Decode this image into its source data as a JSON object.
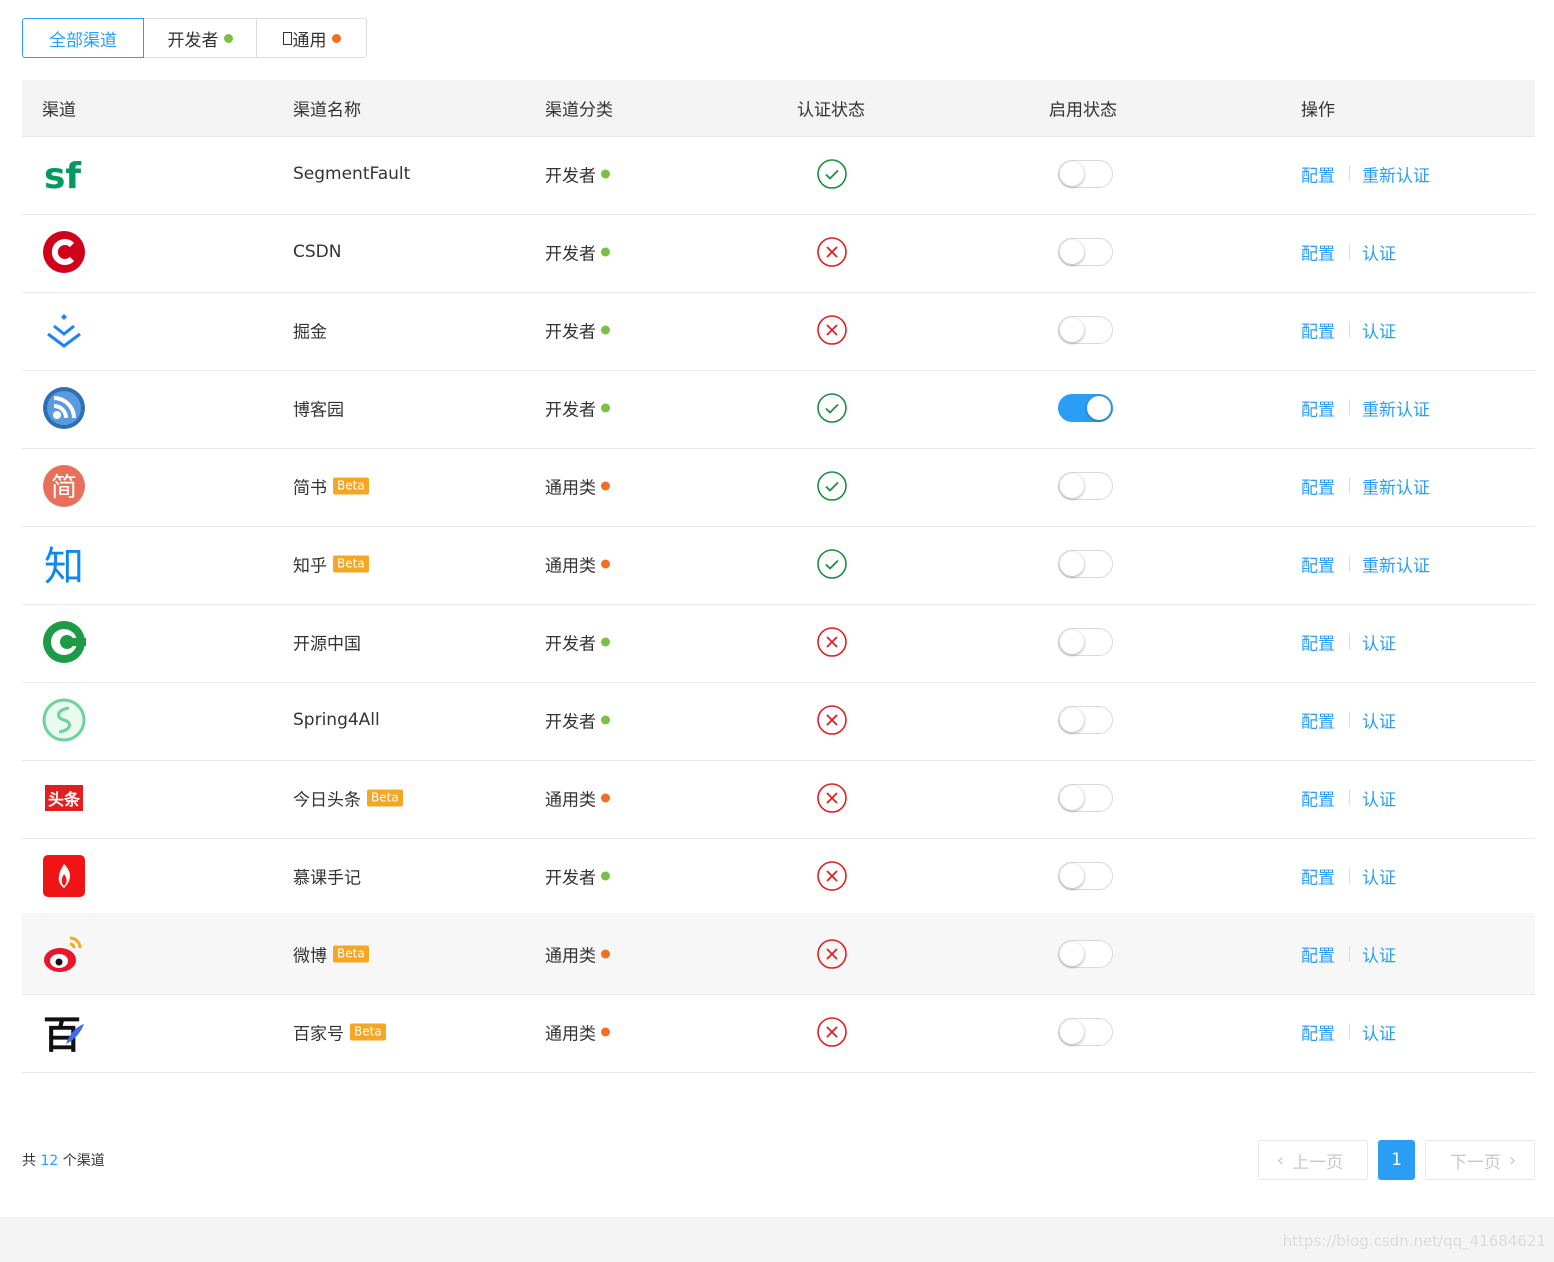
{
  "tabs": [
    {
      "label": "全部渠道",
      "active": true
    },
    {
      "label": "开发者",
      "dot_color": "#7ac143"
    },
    {
      "label": "通用",
      "dot_color": "#f26f21"
    }
  ],
  "table": {
    "headers": {
      "channel": "渠道",
      "name": "渠道名称",
      "category": "渠道分类",
      "auth_status": "认证状态",
      "enable_status": "启用状态",
      "actions": "操作"
    },
    "rows": [
      {
        "logo": "segmentfault-logo",
        "name": "SegmentFault",
        "beta": "",
        "category": "开发者",
        "cat_color": "#7ac143",
        "authed": true,
        "enabled": false,
        "config": "配置",
        "auth_action": "重新认证"
      },
      {
        "logo": "csdn-logo",
        "name": "CSDN",
        "beta": "",
        "category": "开发者",
        "cat_color": "#7ac143",
        "authed": false,
        "enabled": false,
        "config": "配置",
        "auth_action": "认证"
      },
      {
        "logo": "juejin-logo",
        "name": "掘金",
        "beta": "",
        "category": "开发者",
        "cat_color": "#7ac143",
        "authed": false,
        "enabled": false,
        "config": "配置",
        "auth_action": "认证"
      },
      {
        "logo": "cnblogs-logo",
        "name": "博客园",
        "beta": "",
        "category": "开发者",
        "cat_color": "#7ac143",
        "authed": true,
        "enabled": true,
        "config": "配置",
        "auth_action": "重新认证"
      },
      {
        "logo": "jianshu-logo",
        "name": "简书",
        "beta": "Beta",
        "category": "通用类",
        "cat_color": "#f26f21",
        "authed": true,
        "enabled": false,
        "config": "配置",
        "auth_action": "重新认证"
      },
      {
        "logo": "zhihu-logo",
        "name": "知乎",
        "beta": "Beta",
        "category": "通用类",
        "cat_color": "#f26f21",
        "authed": true,
        "enabled": false,
        "config": "配置",
        "auth_action": "重新认证"
      },
      {
        "logo": "oschina-logo",
        "name": "开源中国",
        "beta": "",
        "category": "开发者",
        "cat_color": "#7ac143",
        "authed": false,
        "enabled": false,
        "config": "配置",
        "auth_action": "认证"
      },
      {
        "logo": "spring4all-logo",
        "name": "Spring4All",
        "beta": "",
        "category": "开发者",
        "cat_color": "#7ac143",
        "authed": false,
        "enabled": false,
        "config": "配置",
        "auth_action": "认证"
      },
      {
        "logo": "toutiao-logo",
        "name": "今日头条",
        "beta": "Beta",
        "category": "通用类",
        "cat_color": "#f26f21",
        "authed": false,
        "enabled": false,
        "config": "配置",
        "auth_action": "认证"
      },
      {
        "logo": "imooc-logo",
        "name": "慕课手记",
        "beta": "",
        "category": "开发者",
        "cat_color": "#7ac143",
        "authed": false,
        "enabled": false,
        "config": "配置",
        "auth_action": "认证"
      },
      {
        "logo": "weibo-logo",
        "name": "微博",
        "beta": "Beta",
        "category": "通用类",
        "cat_color": "#f26f21",
        "authed": false,
        "enabled": false,
        "config": "配置",
        "auth_action": "认证"
      },
      {
        "logo": "baijiahao-logo",
        "name": "百家号",
        "beta": "Beta",
        "category": "通用类",
        "cat_color": "#f26f21",
        "authed": false,
        "enabled": false,
        "config": "配置",
        "auth_action": "认证"
      }
    ]
  },
  "footer": {
    "total_prefix": "共 ",
    "total_count": "12",
    "total_suffix": " 个渠道",
    "prev_label": "上一页",
    "current_page": "1",
    "next_label": "下一页"
  },
  "watermark": "https://blog.csdn.net/qq_41684621",
  "colors": {
    "accent": "#2a9ef5",
    "success": "#1a8f3c",
    "error": "#e02020",
    "beta": "#f5a623"
  }
}
